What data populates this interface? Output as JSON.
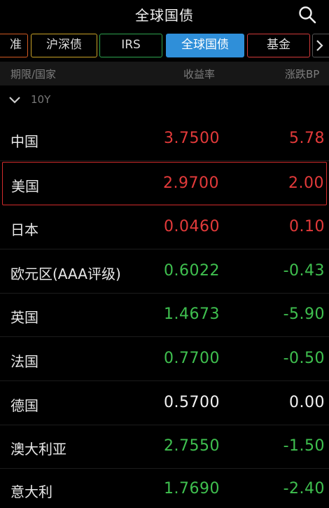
{
  "header": {
    "title": "全球国债"
  },
  "tabs": [
    {
      "label": "准",
      "border": "#d25a22",
      "active": false
    },
    {
      "label": "沪深债",
      "border": "#c9a227",
      "active": false
    },
    {
      "label": "IRS",
      "border": "#2ea44f",
      "active": false
    },
    {
      "label": "全球国债",
      "border": "#2f8fd9",
      "active": true
    },
    {
      "label": "基金",
      "border": "#d23a3a",
      "active": false
    }
  ],
  "columns": {
    "name": "期限/国家",
    "yield": "收益率",
    "change": "涨跌BP"
  },
  "group": {
    "label": "10Y"
  },
  "rows": [
    {
      "name": "中国",
      "yield": "3.7500",
      "change": "5.78",
      "trend": "up"
    },
    {
      "name": "美国",
      "yield": "2.9700",
      "change": "2.00",
      "trend": "up",
      "selected": true
    },
    {
      "name": "日本",
      "yield": "0.0460",
      "change": "0.10",
      "trend": "up"
    },
    {
      "name": "欧元区(AAA评级)",
      "yield": "0.6022",
      "change": "-0.43",
      "trend": "down"
    },
    {
      "name": "英国",
      "yield": "1.4673",
      "change": "-5.90",
      "trend": "down"
    },
    {
      "name": "法国",
      "yield": "0.7700",
      "change": "-0.50",
      "trend": "down"
    },
    {
      "name": "德国",
      "yield": "0.5700",
      "change": "0.00",
      "trend": "flat"
    },
    {
      "name": "澳大利亚",
      "yield": "2.7550",
      "change": "-1.50",
      "trend": "down"
    },
    {
      "name": "意大利",
      "yield": "1.7690",
      "change": "-2.40",
      "trend": "down"
    }
  ],
  "colors": {
    "up": "#e33a3a",
    "down": "#3fc04f",
    "flat": "#f2f2f2",
    "accent": "#2f8fd9",
    "selected_border": "#d22c2c"
  }
}
